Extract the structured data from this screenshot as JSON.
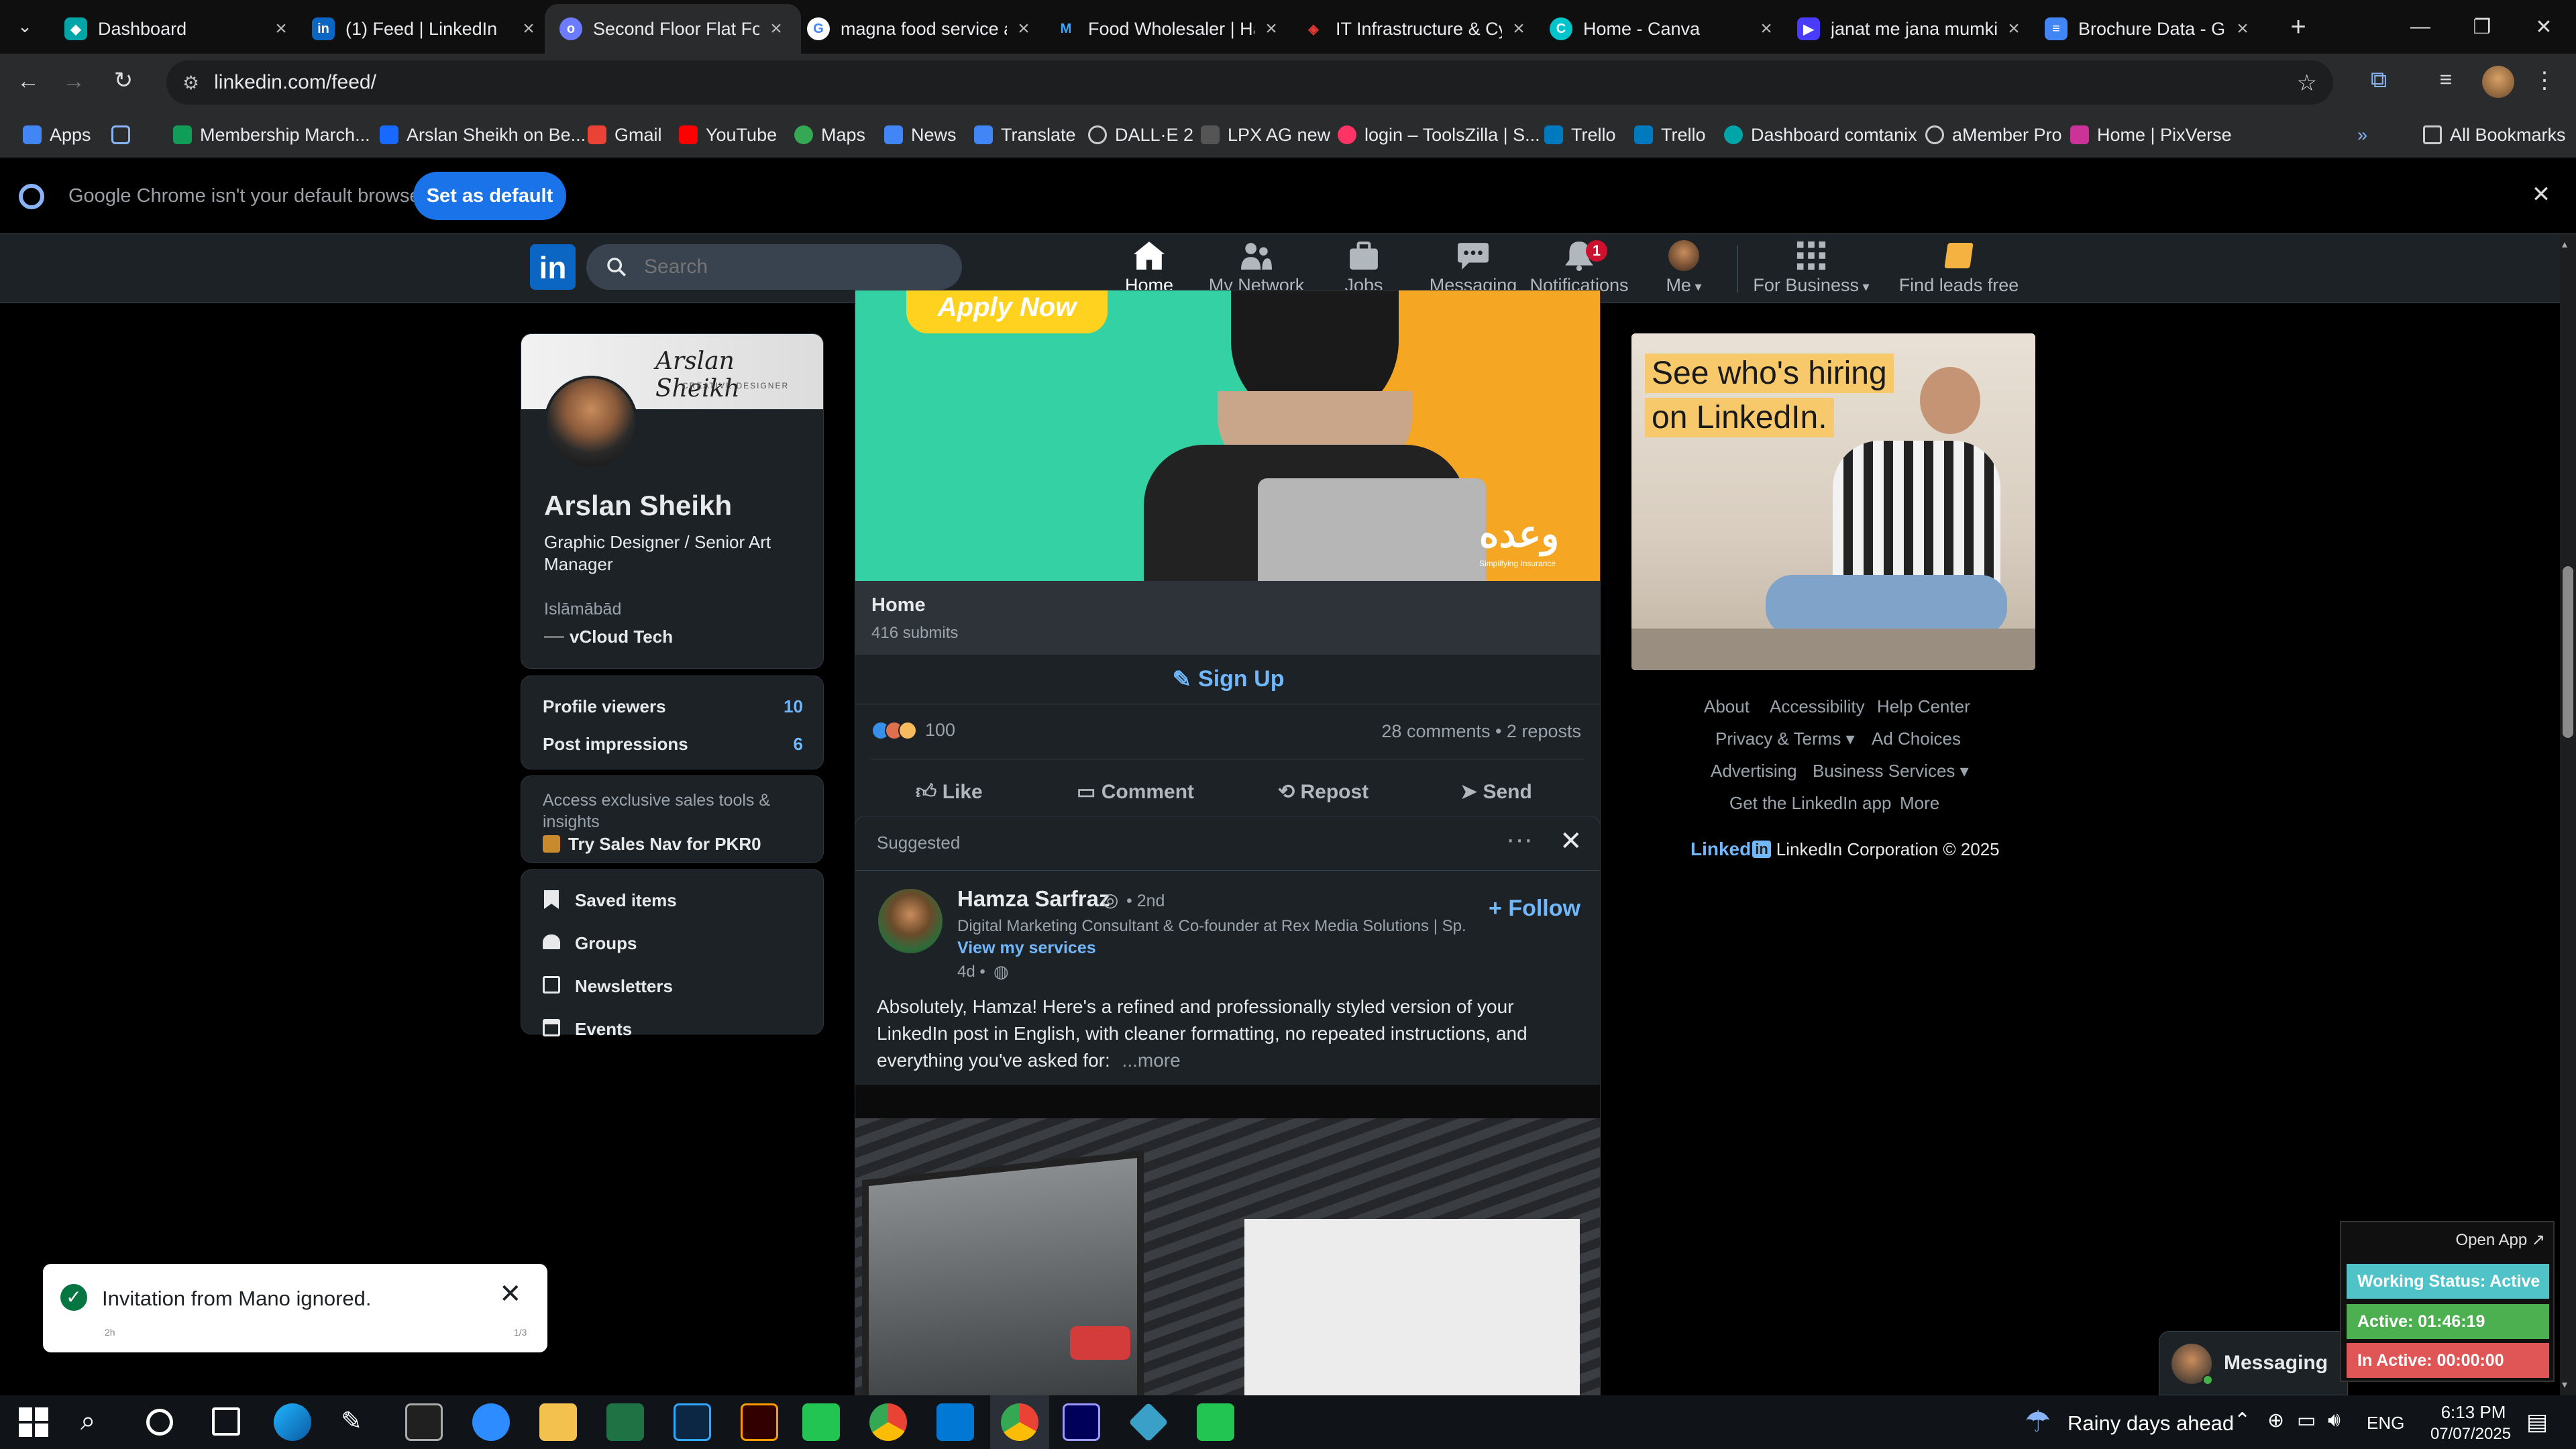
{
  "browser": {
    "tabs": [
      {
        "title": "Dashboard",
        "favicon_color": "#00a5a8"
      },
      {
        "title": "(1) Feed | LinkedIn",
        "favicon_color": "#0a66c2"
      },
      {
        "title": "Second Floor Flat For",
        "favicon_color": "#6d7cff"
      },
      {
        "title": "magna food service a",
        "favicon_color": "#ffffff"
      },
      {
        "title": "Food Wholesaler | Ha",
        "favicon_color": "#3ea6ff"
      },
      {
        "title": "IT Infrastructure & Cy",
        "favicon_color": "#e53935"
      },
      {
        "title": "Home - Canva",
        "favicon_color": "#00c4cc"
      },
      {
        "title": "janat me jana mumki",
        "favicon_color": "#4a3cff"
      },
      {
        "title": "Brochure Data - Goo",
        "favicon_color": "#4285f4"
      }
    ],
    "url": "linkedin.com/feed/",
    "bookmarks": [
      {
        "label": "Apps",
        "color": "#4285f4"
      },
      {
        "label": "Membership March...",
        "color": "#0f9d58"
      },
      {
        "label": "Arslan Sheikh on Be...",
        "color": "#1769ff"
      },
      {
        "label": "Gmail",
        "color": "#ea4335"
      },
      {
        "label": "YouTube",
        "color": "#ff0000"
      },
      {
        "label": "Maps",
        "color": "#34a853"
      },
      {
        "label": "News",
        "color": "#4285f4"
      },
      {
        "label": "Translate",
        "color": "#4285f4"
      },
      {
        "label": "DALL·E 2",
        "color": "#cccccc"
      },
      {
        "label": "LPX AG new",
        "color": "#888888"
      },
      {
        "label": "login – ToolsZilla | S...",
        "color": "#ff3366"
      },
      {
        "label": "Trello",
        "color": "#0079bf"
      },
      {
        "label": "Trello",
        "color": "#0079bf"
      },
      {
        "label": "Dashboard comtanix",
        "color": "#00a5a8"
      },
      {
        "label": "aMember Pro",
        "color": "#cccccc"
      },
      {
        "label": "Home | PixVerse",
        "color": "#cc3399"
      }
    ],
    "all_bookmarks": "All Bookmarks",
    "infobar": {
      "message": "Google Chrome isn't your default browser",
      "button": "Set as default"
    }
  },
  "linkedin": {
    "search_placeholder": "Search",
    "nav": [
      {
        "label": "Home",
        "icon": "home-icon",
        "active": true
      },
      {
        "label": "My Network",
        "icon": "network-icon"
      },
      {
        "label": "Jobs",
        "icon": "jobs-icon"
      },
      {
        "label": "Messaging",
        "icon": "messaging-icon"
      },
      {
        "label": "Notifications",
        "icon": "bell-icon",
        "badge": "1"
      },
      {
        "label": "Me",
        "icon": "avatar"
      },
      {
        "label": "For Business",
        "icon": "grid-icon"
      },
      {
        "label": "Find leads free",
        "icon": "leads-icon"
      }
    ],
    "profile": {
      "banner_script": "Arslan Sheikh",
      "banner_sub": "CREATIVE DESIGNER",
      "name": "Arslan Sheikh",
      "headline": "Graphic Designer / Senior Art Manager",
      "location": "Islāmābād",
      "company": "vCloud Tech",
      "stats": [
        {
          "label": "Profile viewers",
          "value": "10"
        },
        {
          "label": "Post impressions",
          "value": "6"
        }
      ],
      "promo_text": "Access exclusive sales tools & insights",
      "promo_link": "Try Sales Nav for PKR0",
      "shortcuts": [
        "Saved items",
        "Groups",
        "Newsletters",
        "Events"
      ]
    },
    "ad_post": {
      "image_text": "Apply Now",
      "brand_text": "وعده",
      "brand_sub": "Simplifying Insurance",
      "title": "Home",
      "submits": "416 submits",
      "signup": "Sign Up",
      "reactions_count": "100",
      "comments_reposts": "28 comments • 2 reposts",
      "actions": [
        "Like",
        "Comment",
        "Repost",
        "Send"
      ]
    },
    "suggested_post": {
      "label": "Suggested",
      "author": "Hamza Sarfraz",
      "degree": "• 2nd",
      "headline": "Digital Marketing Consultant & Co-founder at Rex Media Solutions | Sp...",
      "services_link": "View my services",
      "time": "4d •",
      "follow": "Follow",
      "text": "Absolutely, Hamza! Here's a refined and professionally styled version of your LinkedIn post in English, with cleaner formatting, no repeated instructions, and everything you've asked for:",
      "more": "...more"
    },
    "right_ad": {
      "line1": "See who's hiring",
      "line2": "on LinkedIn."
    },
    "footer": {
      "links": [
        "About",
        "Accessibility",
        "Help Center",
        "Privacy & Terms",
        "Ad Choices",
        "Advertising",
        "Business Services",
        "Get the LinkedIn app",
        "More"
      ],
      "brand": "Linked",
      "copyright": "LinkedIn Corporation © 2025"
    },
    "toast": {
      "message": "Invitation from Mano ignored.",
      "left_meta": "2h",
      "right_meta": "1/3"
    },
    "messaging": "Messaging"
  },
  "tracker": {
    "open_app": "Open App ↗",
    "status": "Working Status: Active",
    "active": "Active: 01:46:19",
    "inactive": "In Active: 00:00:00"
  },
  "taskbar": {
    "weather": "Rainy days ahead",
    "lang": "ENG",
    "time": "6:13 PM",
    "date": "07/07/2025"
  },
  "colors": {
    "linkedin_blue": "#0a66c2",
    "link_blue": "#71b7fb",
    "chrome_blue": "#1a73e8",
    "tracker_green": "#4caf50",
    "tracker_red": "#e05555"
  }
}
